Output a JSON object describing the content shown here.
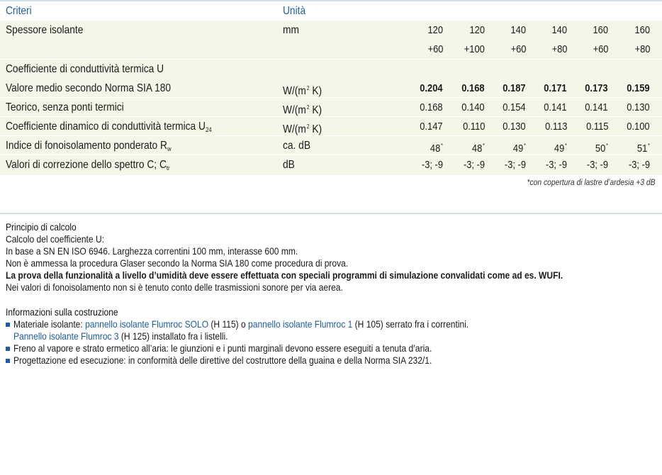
{
  "table": {
    "header": {
      "criteria": "Criteri",
      "unit": "Unità"
    },
    "rows": {
      "thickness": {
        "label": "Spessore isolante",
        "unit": "mm",
        "values_top": [
          "120",
          "120",
          "140",
          "140",
          "160",
          "160"
        ],
        "values_bottom": [
          "+60",
          "+100",
          "+60",
          "+80",
          "+60",
          "+80"
        ]
      },
      "u_section": {
        "label": "Coefficiente di conduttività termica U"
      },
      "u_mean": {
        "label": "Valore medio secondo Norma SIA 180",
        "unit_main": "W/(m",
        "unit_sup": "2",
        "unit_tail": " K)",
        "values": [
          "0.204",
          "0.168",
          "0.187",
          "0.171",
          "0.173",
          "0.159"
        ]
      },
      "u_theory": {
        "label": "Teorico, senza ponti termici",
        "unit_main": "W/(m",
        "unit_sup": "2",
        "unit_tail": " K)",
        "values": [
          "0.168",
          "0.140",
          "0.154",
          "0.141",
          "0.141",
          "0.130"
        ]
      },
      "u24": {
        "label_main": "Coefficiente dinamico di conduttività termica U",
        "label_sub": "24",
        "unit_main": "W/(m",
        "unit_sup": "2",
        "unit_tail": " K)",
        "values": [
          "0.147",
          "0.110",
          "0.130",
          "0.113",
          "0.115",
          "0.100"
        ]
      },
      "rw": {
        "label_main": "Indice di fonoisolamento ponderato R",
        "label_sub": "w",
        "unit": "ca. dB",
        "values": [
          "48",
          "48",
          "49",
          "49",
          "50",
          "51"
        ],
        "mark": "*"
      },
      "spectrum": {
        "label_main": "Valori di correzione dello spettro C; C",
        "label_sub": "tr",
        "unit": "dB",
        "values": [
          "-3; -9",
          "-3; -9",
          "-3; -9",
          "-3; -9",
          "-3; -9",
          "-3; -9"
        ]
      }
    },
    "footnote": "*con copertura di lastre d’ardesia +3 dB"
  },
  "calc": {
    "heading": "Principio di calcolo",
    "line1": "Calcolo del coefficiente U:",
    "line2": "In base a SN EN ISO 6946. Larghezza correntini 100 mm, interasse 600 mm.",
    "line3": "Non è ammessa la procedura Glaser secondo la Norma SIA 180 come procedura di prova.",
    "line4": "La prova della funzionalità a livello d’umidità deve essere effettuata con speciali programmi di simulazione convalidati come ad es. WUFI.",
    "line5": "Nei valori di fonoisolamento non si è tenuto conto delle trasmissioni sonore per via aerea."
  },
  "construction": {
    "heading": "Informazioni sulla costruzione",
    "b1_a": "Materiale isolante: ",
    "b1_link1": "pannello isolante Flumroc SOLO",
    "b1_b": " (H 115) o ",
    "b1_link2": "pannello isolante Flumroc 1",
    "b1_c": " (H 105) serrato fra i correntini.",
    "b1_link3": "Pannello isolante Flumroc 3",
    "b1_d": " (H 125) installato fra i listelli.",
    "b2": "Freno al vapore e strato ermetico all’aria: le giunzioni e i punti marginali devono essere eseguiti a tenuta d’aria.",
    "b3": "Progettazione ed esecuzione: in conformità delle direttive del costruttore della guaina e della Norma SIA 232/1."
  },
  "colors": {
    "accent_blue": "#1f5ca8",
    "row_shade": "#f4f7e8",
    "rule": "#cfe1ea"
  }
}
